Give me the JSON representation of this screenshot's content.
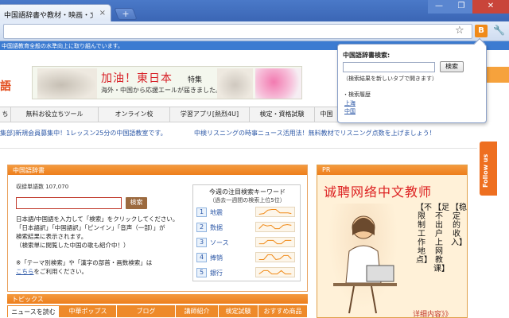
{
  "browser": {
    "tab_title": "中国語辞書や教材・映画・文",
    "tab_close": "×",
    "new_tab": "+",
    "win_min": "—",
    "win_max": "❐",
    "win_close": "✕",
    "ext_label": "B",
    "star_glyph": "☆",
    "wrench_glyph": "🔧"
  },
  "page": {
    "tagline": "中国語教育全般の水準向上に取り組んでいます。",
    "logo_fragment": "語",
    "banner": {
      "title": "加油！東日本",
      "badge": "特集",
      "sub": "海外・中国から応援エールが届きました。"
    },
    "nav": [
      "ち",
      "無料お役立ちツール",
      "オンライン校",
      "学習アプリ[熱烈4U]",
      "検定・資格試験",
      "中国"
    ],
    "ticker": {
      "left": "集部]新規会員募集中！1レッスン25分の中国語教室です。",
      "right": "中検リスニングの時事ニュース活用法！無料教材でリスニング点数を上げましょう！"
    },
    "dictionary": {
      "title": "中国語辞書",
      "word_count": "収録単語数 107,070",
      "search_button": "検索",
      "lines": [
        "日本語/中国語を入力して「検索」をクリックしてください。",
        "「日本語訳」「中国語訳」「ピンイン」「音声（一部）」が",
        "検索結果に表示されます。",
        "（検索単に閲覧した中国の歌も紹介中！）",
        "※「テーマ別検索」や「漢字の部首・画数検索」は"
      ],
      "link": "こちら",
      "link_tail": "をご利用ください。"
    },
    "keywords": {
      "title": "今週の注目検索キーワード",
      "sub": "（過去一週間の検索上位5位）",
      "items": [
        {
          "rank": "1",
          "word": "地震"
        },
        {
          "rank": "2",
          "word": "数据"
        },
        {
          "rank": "3",
          "word": "ソース"
        },
        {
          "rank": "4",
          "word": "捧销"
        },
        {
          "rank": "5",
          "word": "銀行"
        }
      ]
    },
    "topics": {
      "title": "トピックス",
      "tabs": [
        "ニュースを読む",
        "中華ポップス",
        "ブログ",
        "講師紹介",
        "検定試験",
        "おすすめ商品"
      ]
    },
    "pr": {
      "label": "PR",
      "headline": "诚聘网络中文教师",
      "vertical": [
        "【稳定的收入】",
        "【足不出户上网教课】",
        "【不限制工作地点】"
      ],
      "more": "详细内容》》"
    },
    "follow": "Follow us"
  },
  "popup": {
    "title": "中国語辞書検索:",
    "button": "検索",
    "note": "（検索結果を新しいタブで開きます）",
    "history_title": "・検索履歴",
    "history": [
      "上海",
      "中国"
    ]
  }
}
